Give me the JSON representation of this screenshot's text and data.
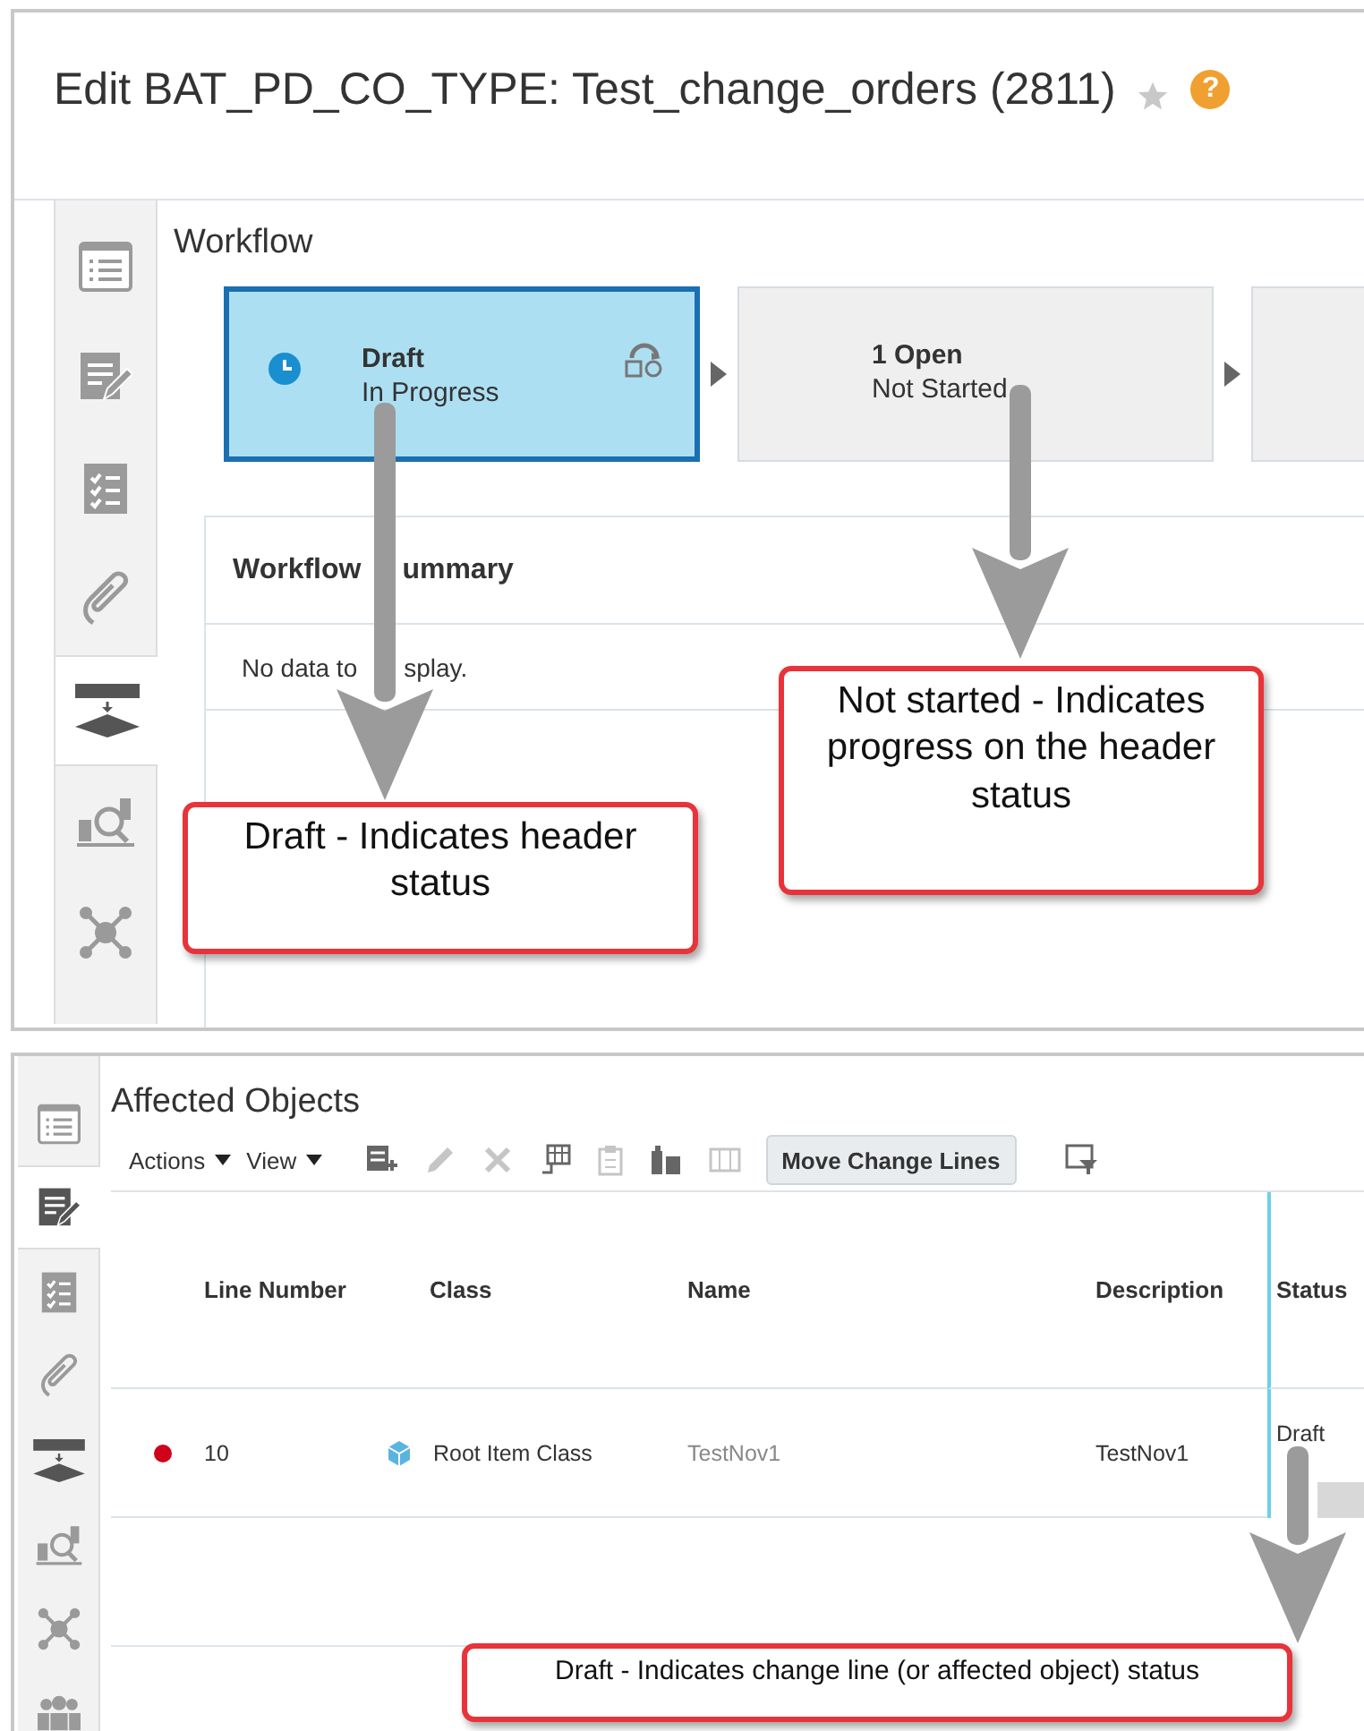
{
  "edit_panel": {
    "title": "Edit BAT_PD_CO_TYPE: Test_change_orders (2811)",
    "help": "?",
    "sidebar": [
      {
        "selected": false
      },
      {
        "selected": false
      },
      {
        "selected": false
      },
      {
        "selected": false
      },
      {
        "selected": true
      },
      {
        "selected": false
      },
      {
        "selected": false
      }
    ],
    "section_title": "Workflow",
    "steps": [
      {
        "name": "Draft",
        "status": "In Progress",
        "selected": true
      },
      {
        "name": "1 Open",
        "status": "Not Started",
        "selected": false
      }
    ],
    "summary": {
      "title_parts": [
        "Workflow",
        "ummary"
      ],
      "empty_text_parts": [
        "No data to",
        "splay."
      ]
    }
  },
  "affected_objects_panel": {
    "title": "Affected Objects",
    "sidebar": [
      {
        "selected": false
      },
      {
        "selected": true
      },
      {
        "selected": false
      },
      {
        "selected": false
      },
      {
        "selected": false
      },
      {
        "selected": false
      },
      {
        "selected": false
      },
      {
        "selected": false
      }
    ],
    "menus": [
      "Actions",
      "View"
    ],
    "tools": [
      {
        "kind": "icon",
        "disabled": false
      },
      {
        "kind": "icon",
        "disabled": true
      },
      {
        "kind": "icon",
        "disabled": true
      },
      {
        "kind": "icon",
        "disabled": false
      },
      {
        "kind": "icon",
        "disabled": true
      },
      {
        "kind": "icon",
        "disabled": false
      },
      {
        "kind": "icon",
        "disabled": true
      },
      {
        "kind": "button",
        "label": "Move Change Lines",
        "disabled": false
      },
      {
        "kind": "icon",
        "disabled": false
      }
    ],
    "columns": [
      "Line Number",
      "Class",
      "Name",
      "Description",
      "Status"
    ],
    "rows": [
      {
        "color": "#d0021b",
        "line_number": "10",
        "class": "Root Item Class",
        "name": "TestNov1",
        "description": "TestNov1",
        "status": "Draft"
      }
    ]
  },
  "callouts": [
    {
      "text": "Draft - Indicates header status"
    },
    {
      "text": "Not started - Indicates progress on the header status"
    },
    {
      "text": "Draft - Indicates change line (or affected object) status"
    }
  ]
}
